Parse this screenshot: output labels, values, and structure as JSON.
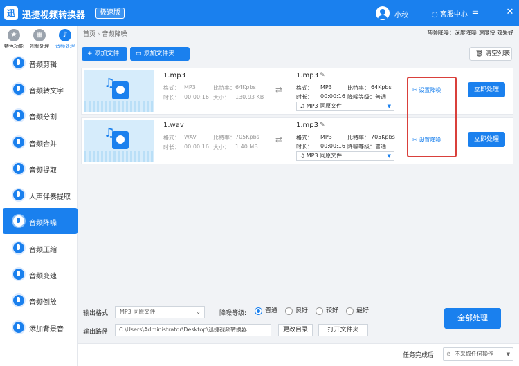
{
  "titlebar": {
    "logo": "迅",
    "title": "迅捷视频转换器",
    "edition": "极速版",
    "user": "小秋",
    "service": "客服中心",
    "menu_glyph": "≡",
    "minimize_glyph": "—",
    "close_glyph": "✕"
  },
  "sidebar": {
    "top_categories": [
      {
        "label": "特色功能",
        "glyph": "★"
      },
      {
        "label": "视频处理",
        "glyph": "▦"
      },
      {
        "label": "音频处理",
        "glyph": "♪"
      }
    ],
    "items": [
      {
        "label": "音频剪辑"
      },
      {
        "label": "音频转文字"
      },
      {
        "label": "音频分割"
      },
      {
        "label": "音频合并"
      },
      {
        "label": "音频提取"
      },
      {
        "label": "人声伴奏提取"
      },
      {
        "label": "音频降噪"
      },
      {
        "label": "音频压缩"
      },
      {
        "label": "音频变速"
      },
      {
        "label": "音频倒放"
      },
      {
        "label": "添加背景音"
      }
    ]
  },
  "main": {
    "breadcrumb": {
      "home": "首页",
      "current": "音频降噪"
    },
    "noise_summary": "音频降噪：深度降噪 速度快 效果好",
    "add_file": "+ 添加文件",
    "add_folder": "▭ 添加文件夹",
    "clear_list": "🗑 清空列表",
    "files": [
      {
        "input_name": "1.mp3",
        "input_format_label": "格式：",
        "input_format": "MP3",
        "input_bitrate_label": "比特率：",
        "input_bitrate": "64Kpbs",
        "input_duration_label": "时长：",
        "input_duration": "00:00:16",
        "input_size_label": "大小：",
        "input_size": "130.93 KB",
        "output_name": "1.mp3",
        "output_format_label": "格式：",
        "output_format": "MP3",
        "output_bitrate_label": "比特率：",
        "output_bitrate": "64Kpbs",
        "output_duration_label": "时长：",
        "output_duration": "00:00:16",
        "noise_level_label": "降噪等级：",
        "noise_level": "普通",
        "output_select": "♫ MP3  同原文件",
        "set_noise": "设置降噪",
        "process": "立即处理"
      },
      {
        "input_name": "1.wav",
        "input_format_label": "格式：",
        "input_format": "WAV",
        "input_bitrate_label": "比特率：",
        "input_bitrate": "705Kpbs",
        "input_duration_label": "时长：",
        "input_duration": "00:00:16",
        "input_size_label": "大小：",
        "input_size": "1.40 MB",
        "output_name": "1.mp3",
        "output_format_label": "格式：",
        "output_format": "MP3",
        "output_bitrate_label": "比特率：",
        "output_bitrate": "705Kpbs",
        "output_duration_label": "时长：",
        "output_duration": "00:00:16",
        "noise_level_label": "降噪等级：",
        "noise_level": "普通",
        "output_select": "♫ MP3  同原文件",
        "set_noise": "设置降噪",
        "process": "立即处理"
      }
    ]
  },
  "bottom": {
    "output_format_label": "输出格式:",
    "output_format_value": "MP3  同原文件",
    "noise_level_label": "降噪等级:",
    "levels": [
      "普通",
      "良好",
      "较好",
      "最好"
    ],
    "selected_level": "普通",
    "output_path_label": "输出路径:",
    "output_path": "C:\\Users\\Administrator\\Desktop\\迅捷视频转换器",
    "change_dir": "更改目录",
    "open_folder": "打开文件夹",
    "process_all": "全部处理"
  },
  "status": {
    "after_label": "任务完成后",
    "after_value": "不采取任何操作",
    "after_icon": "⊘"
  },
  "colors": {
    "accent": "#1a80ee",
    "highlight": "#d9403b"
  }
}
